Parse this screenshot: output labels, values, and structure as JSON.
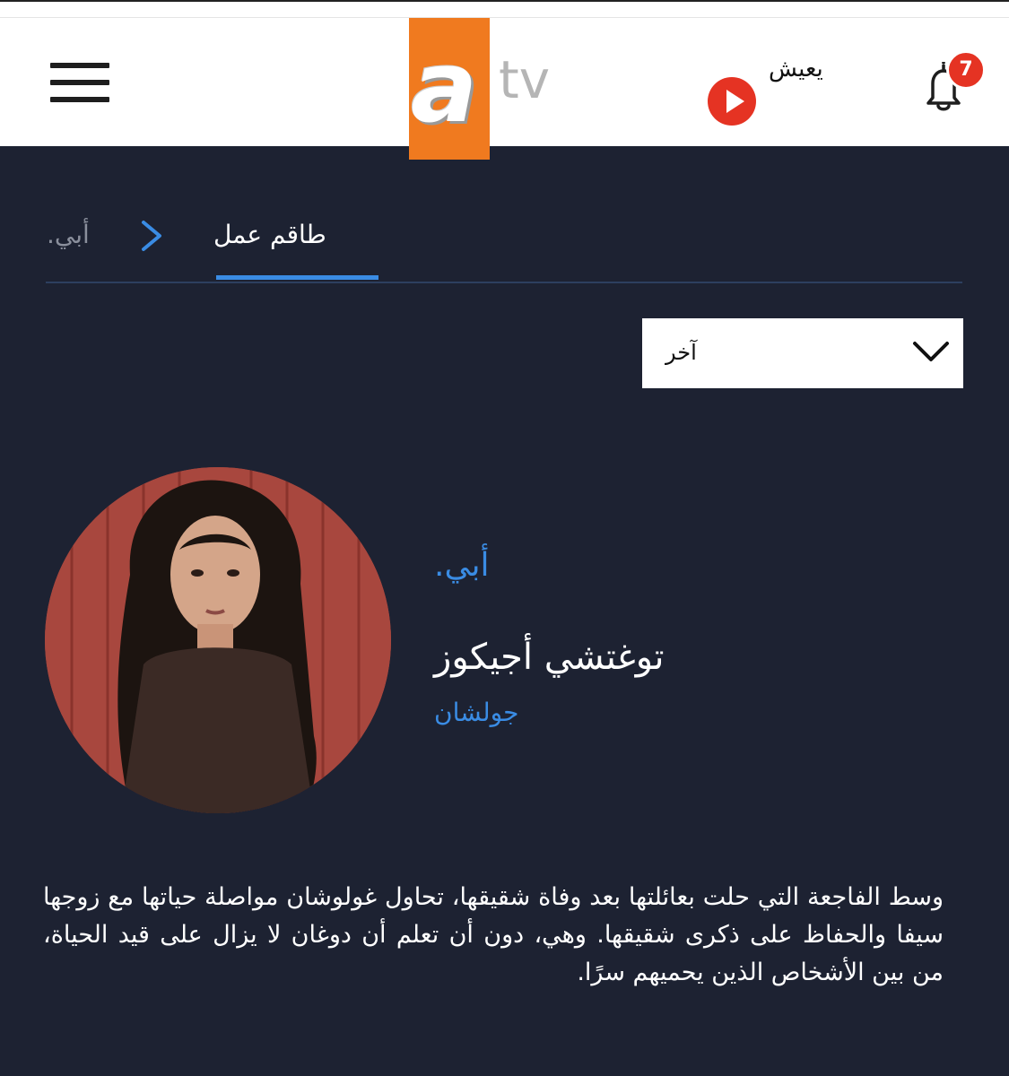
{
  "header": {
    "logo_a": "a",
    "logo_tv": "tv",
    "live_label": "يعيش",
    "notification_count": "7"
  },
  "breadcrumb": {
    "current": "طاقم عمل",
    "back": "أبي."
  },
  "filter": {
    "selected": "آخر"
  },
  "cast": {
    "show": "أبي.",
    "actor_name": "توغتشي أجيكوز",
    "role": "جولشان",
    "description": "وسط الفاجعة التي حلت بعائلتها بعد وفاة شقيقها، تحاول غولوشان مواصلة حياتها مع زوجها سيفا والحفاظ على ذكرى شقيقها. وهي، دون أن تعلم أن دوغان لا يزال على قيد الحياة، من بين الأشخاص الذين يحميهم سرًا."
  },
  "colors": {
    "background": "#1d2232",
    "accent_blue": "#3a8ce4",
    "logo_orange": "#f07a1f",
    "live_red": "#e53323"
  },
  "icons": [
    "menu-icon",
    "play-icon",
    "bell-icon",
    "chevron-right-icon",
    "chevron-down-icon"
  ]
}
